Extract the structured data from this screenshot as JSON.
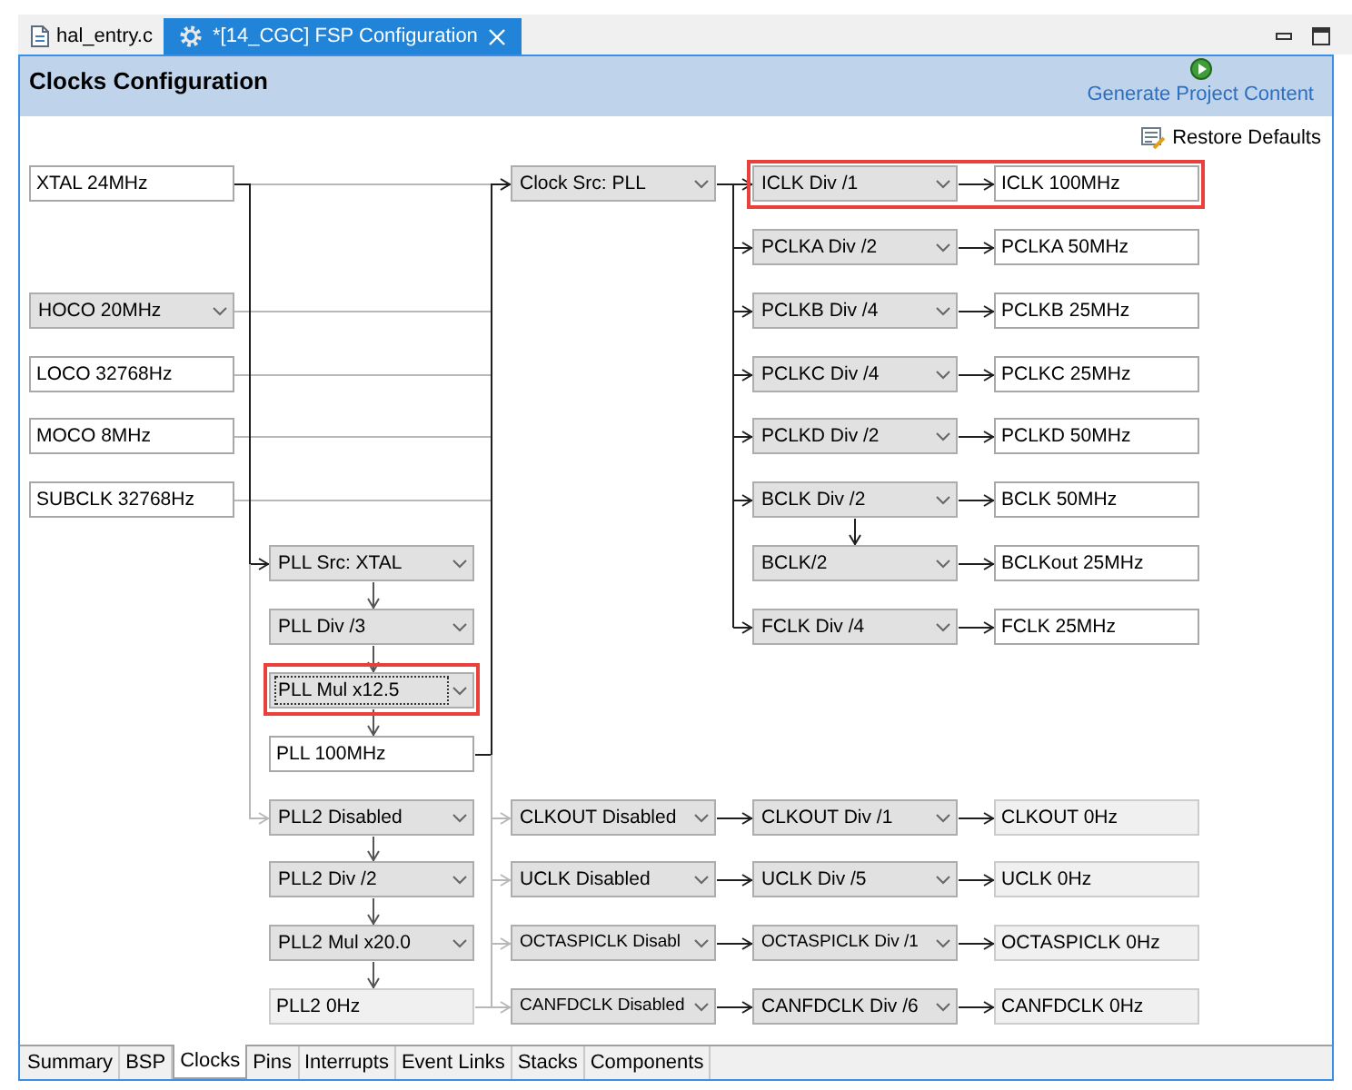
{
  "editor_tabs": [
    {
      "label": "hal_entry.c",
      "kind": "source_file",
      "selected": false,
      "closable": false
    },
    {
      "label": "*[14_CGC] FSP Configuration",
      "kind": "configuration",
      "selected": true,
      "closable": true
    }
  ],
  "header": {
    "title": "Clocks Configuration",
    "generate_link": "Generate Project Content"
  },
  "toolbar": {
    "restore_defaults": "Restore Defaults"
  },
  "clock_tree": {
    "sources": [
      {
        "label": "XTAL 24MHz",
        "kind": "field"
      },
      {
        "label": "HOCO 20MHz",
        "kind": "dropdown"
      },
      {
        "label": "LOCO 32768Hz",
        "kind": "field"
      },
      {
        "label": "MOCO 8MHz",
        "kind": "field"
      },
      {
        "label": "SUBCLK 32768Hz",
        "kind": "field"
      }
    ],
    "pll": {
      "steps": [
        {
          "label": "PLL Src: XTAL",
          "highlighted": false,
          "focused": false
        },
        {
          "label": "PLL Div /3",
          "highlighted": false,
          "focused": false
        },
        {
          "label": "PLL Mul x12.5",
          "highlighted": true,
          "focused": true
        }
      ],
      "output": {
        "label": "PLL 100MHz",
        "disabled": false
      }
    },
    "pll2": {
      "steps": [
        {
          "label": "PLL2 Disabled"
        },
        {
          "label": "PLL2 Div /2"
        },
        {
          "label": "PLL2 Mul x20.0"
        }
      ],
      "output": {
        "label": "PLL2 0Hz",
        "disabled": true
      }
    },
    "system_clock": {
      "source": "Clock Src: PLL",
      "branches": [
        {
          "kind": "bus",
          "divider": "ICLK Div /1",
          "output": "ICLK 100MHz",
          "highlighted": true
        },
        {
          "kind": "bus",
          "divider": "PCLKA Div /2",
          "output": "PCLKA 50MHz",
          "highlighted": false
        },
        {
          "kind": "bus",
          "divider": "PCLKB Div /4",
          "output": "PCLKB 25MHz",
          "highlighted": false
        },
        {
          "kind": "bus",
          "divider": "PCLKC Div /4",
          "output": "PCLKC 25MHz",
          "highlighted": false
        },
        {
          "kind": "bus",
          "divider": "PCLKD Div /2",
          "output": "PCLKD 50MHz",
          "highlighted": false
        },
        {
          "kind": "bus",
          "divider": "BCLK Div /2",
          "output": "BCLK 50MHz",
          "highlighted": false
        },
        {
          "kind": "derived",
          "divider": "BCLK/2",
          "output": "BCLKout 25MHz",
          "highlighted": false
        },
        {
          "kind": "bus",
          "divider": "FCLK Div /4",
          "output": "FCLK 25MHz",
          "highlighted": false
        }
      ]
    },
    "peripheral_clocks": [
      {
        "source": "CLKOUT Disabled",
        "divider": "CLKOUT Div /1",
        "output": "CLKOUT 0Hz",
        "disabled": true
      },
      {
        "source": "UCLK Disabled",
        "divider": "UCLK Div /5",
        "output": "UCLK 0Hz",
        "disabled": true
      },
      {
        "source": "OCTASPICLK Disabl",
        "divider": "OCTASPICLK Div /1",
        "output": "OCTASPICLK 0Hz",
        "disabled": true
      },
      {
        "source": "CANFDCLK Disabled",
        "divider": "CANFDCLK Div /6",
        "output": "CANFDCLK 0Hz",
        "disabled": true
      }
    ]
  },
  "page_tabs": [
    {
      "label": "Summary",
      "selected": false
    },
    {
      "label": "BSP",
      "selected": false
    },
    {
      "label": "Clocks",
      "selected": true
    },
    {
      "label": "Pins",
      "selected": false
    },
    {
      "label": "Interrupts",
      "selected": false
    },
    {
      "label": "Event Links",
      "selected": false
    },
    {
      "label": "Stacks",
      "selected": false
    },
    {
      "label": "Components",
      "selected": false
    }
  ]
}
